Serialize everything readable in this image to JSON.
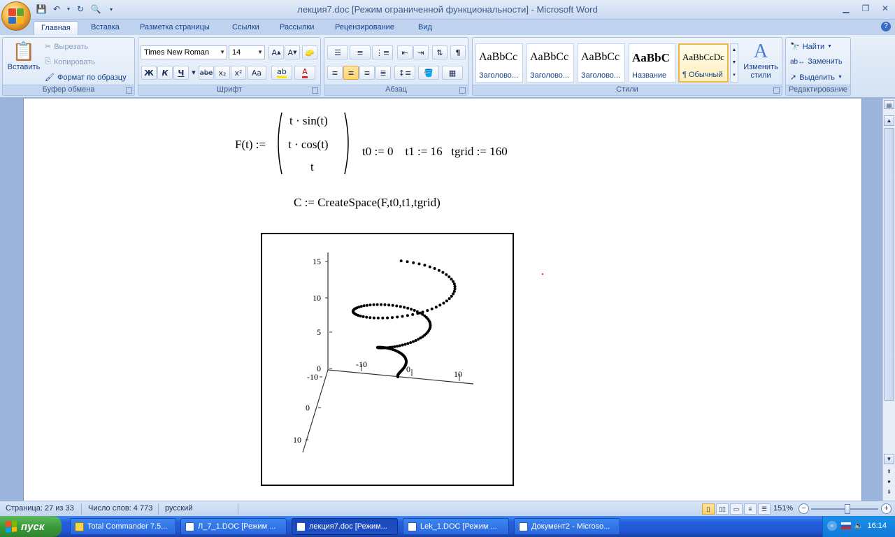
{
  "window": {
    "title": "лекция7.doc [Режим ограниченной функциональности] - Microsoft Word"
  },
  "qat": {
    "icons": [
      "save-icon",
      "undo-icon",
      "redo-icon",
      "print-preview-icon",
      "customize-icon"
    ]
  },
  "tabs": [
    {
      "label": "Главная",
      "active": true
    },
    {
      "label": "Вставка"
    },
    {
      "label": "Разметка страницы"
    },
    {
      "label": "Ссылки"
    },
    {
      "label": "Рассылки"
    },
    {
      "label": "Рецензирование"
    },
    {
      "label": "Вид"
    }
  ],
  "ribbon": {
    "clipboard": {
      "label": "Буфер обмена",
      "paste": "Вставить",
      "cut": "Вырезать",
      "copy": "Копировать",
      "format_painter": "Формат по образцу"
    },
    "font": {
      "label": "Шрифт",
      "family": "Times New Roman",
      "size": "14",
      "bold": "Ж",
      "italic": "К",
      "underline": "Ч",
      "strike": "abe",
      "subscript": "x₂",
      "superscript": "x²",
      "case": "Aa"
    },
    "paragraph": {
      "label": "Абзац",
      "pilcrow": "¶"
    },
    "styles": {
      "label": "Стили",
      "items": [
        {
          "preview": "AaBbCc",
          "name": "Заголово..."
        },
        {
          "preview": "AaBbCc",
          "name": "Заголово..."
        },
        {
          "preview": "AaBbCc",
          "name": "Заголово..."
        },
        {
          "preview": "AaBbC",
          "name": "Название"
        },
        {
          "preview": "AaBbCcDc",
          "name": "¶ Обычный",
          "selected": true
        }
      ],
      "change": "Изменить стили"
    },
    "editing": {
      "label": "Редактирование",
      "find": "Найти",
      "replace": "Заменить",
      "select": "Выделить"
    }
  },
  "document": {
    "func_lhs": "F(t) :=",
    "vector": [
      "t · sin(t)",
      "t · cos(t)",
      "t"
    ],
    "params": "t0 := 0    t1 := 16   tgrid := 160",
    "create": "C := CreateSpace(F,t0,t1,tgrid)",
    "plot": {
      "ticks": [
        "15",
        "10",
        "5",
        "0",
        "-10",
        "0",
        "10",
        "-10",
        "0",
        "10"
      ]
    }
  },
  "status": {
    "page": "Страница: 27 из 33",
    "words": "Число слов: 4 773",
    "lang": "русский",
    "zoom": "151%"
  },
  "taskbar": {
    "start": "пуск",
    "tasks": [
      {
        "label": "Total Commander 7.5..."
      },
      {
        "label": "Л_7_1.DOC [Режим ..."
      },
      {
        "label": "лекция7.doc [Режим...",
        "active": true
      },
      {
        "label": "Lek_1.DOC [Режим ..."
      },
      {
        "label": "Документ2 - Microso..."
      }
    ],
    "clock": "16:14"
  }
}
